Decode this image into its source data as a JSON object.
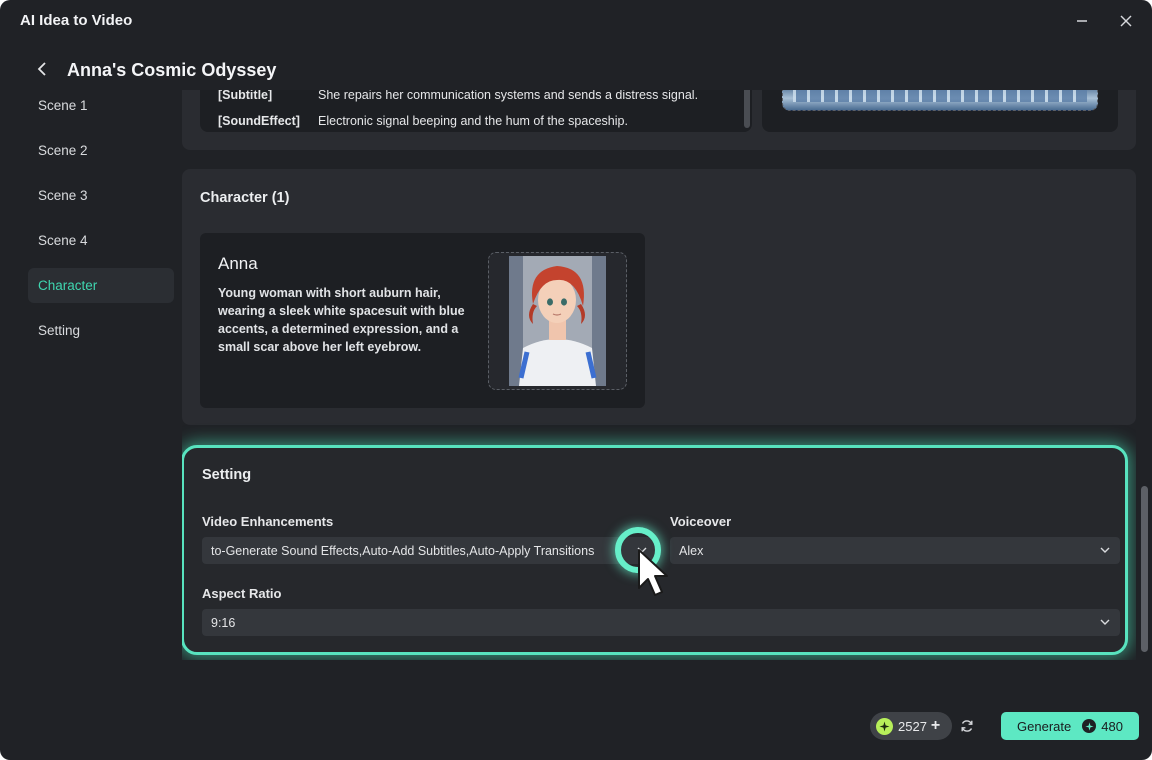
{
  "window": {
    "app_title": "AI Idea to Video"
  },
  "header": {
    "project_title": "Anna's Cosmic Odyssey"
  },
  "sidebar": {
    "items": [
      {
        "label": "Scene 1"
      },
      {
        "label": "Scene 2"
      },
      {
        "label": "Scene 3"
      },
      {
        "label": "Scene 4"
      },
      {
        "label": "Character"
      },
      {
        "label": "Setting"
      }
    ],
    "active": "Character"
  },
  "scene": {
    "rows": [
      {
        "tag": "[Subtitle]",
        "text": "She repairs her communication systems and sends a distress signal."
      },
      {
        "tag": "[SoundEffect]",
        "text": "Electronic signal beeping and the hum of the spaceship."
      }
    ]
  },
  "character": {
    "title": "Character (1)",
    "cards": [
      {
        "name": "Anna",
        "description": "Young woman with short auburn hair, wearing a sleek white spacesuit with blue accents, a determined expression, and a small scar above her left eyebrow."
      }
    ]
  },
  "setting": {
    "title": "Setting",
    "video_enhancements_label": "Video Enhancements",
    "video_enhancements_value": "to-Generate Sound Effects,Auto-Add Subtitles,Auto-Apply Transitions",
    "voiceover_label": "Voiceover",
    "voiceover_value": "Alex",
    "aspect_ratio_label": "Aspect Ratio",
    "aspect_ratio_value": "9:16"
  },
  "footer": {
    "credits": "2527",
    "generate_label": "Generate",
    "generate_cost": "480"
  },
  "colors": {
    "accent": "#5de8c3",
    "highlight": "#58e3bf",
    "background": "#202226",
    "panel": "#2a2c31",
    "credit_coin": "#b7ef5a"
  }
}
